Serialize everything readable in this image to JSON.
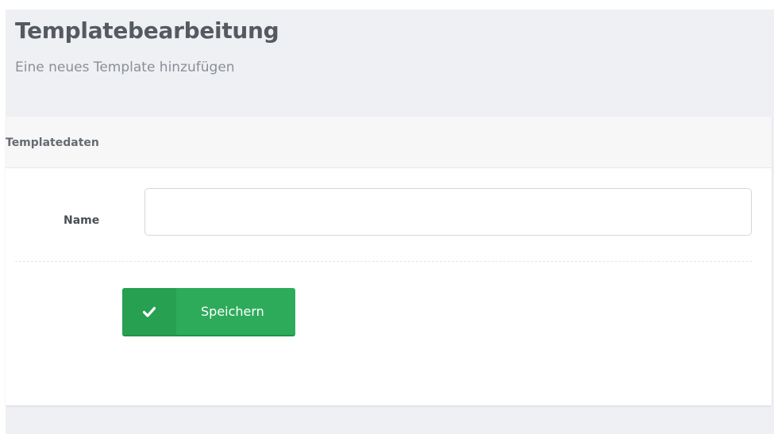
{
  "header": {
    "title": "Templatebearbeitung",
    "subtitle": "Eine neues Template hinzufügen"
  },
  "panel": {
    "title": "Templatedaten"
  },
  "form": {
    "name_label": "Name",
    "name_value": "",
    "name_placeholder": ""
  },
  "actions": {
    "save_label": "Speichern",
    "save_icon": "check-icon"
  },
  "colors": {
    "background": "#eff0f4",
    "panel": "#ffffff",
    "panel_heading": "#f7f7f8",
    "title": "#555a61",
    "button_primary": "#2eab5a",
    "button_icon_area": "#27a051"
  }
}
